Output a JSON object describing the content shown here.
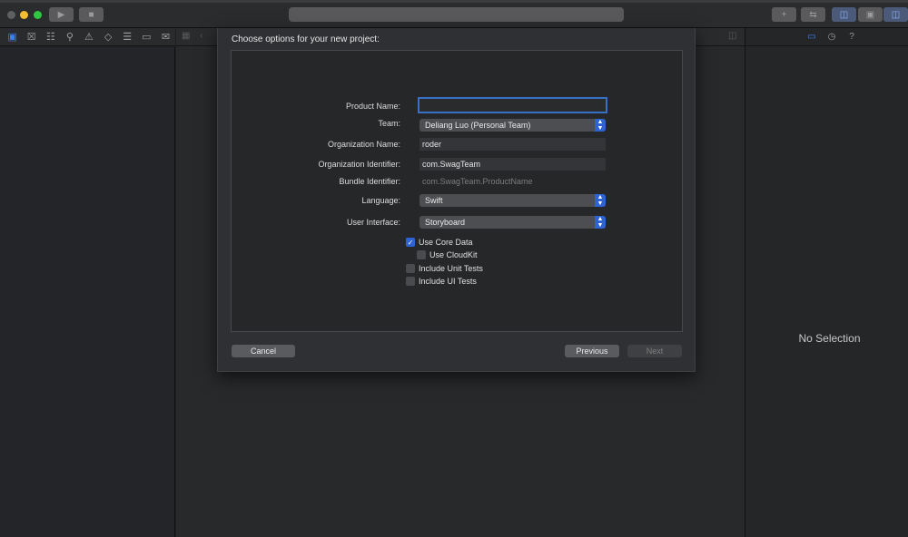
{
  "sheet": {
    "title": "Choose options for your new project:",
    "fields": {
      "product_name": {
        "label": "Product Name:",
        "value": ""
      },
      "team": {
        "label": "Team:",
        "value": "Deliang Luo (Personal Team)"
      },
      "organization_name": {
        "label": "Organization Name:",
        "value": "roder"
      },
      "organization_identifier": {
        "label": "Organization Identifier:",
        "value": "com.SwagTeam"
      },
      "bundle_identifier": {
        "label": "Bundle Identifier:",
        "value": "com.SwagTeam.ProductName"
      },
      "language": {
        "label": "Language:",
        "value": "Swift"
      },
      "user_interface": {
        "label": "User Interface:",
        "value": "Storyboard"
      }
    },
    "checkboxes": {
      "core_data": {
        "label": "Use Core Data",
        "checked": true
      },
      "cloudkit": {
        "label": "Use CloudKit",
        "checked": false
      },
      "unit_tests": {
        "label": "Include Unit Tests",
        "checked": false
      },
      "ui_tests": {
        "label": "Include UI Tests",
        "checked": false
      }
    },
    "buttons": {
      "cancel": "Cancel",
      "previous": "Previous",
      "next": "Next"
    }
  },
  "inspector": {
    "empty_text": "No Selection"
  },
  "colors": {
    "accent": "#2e63d6",
    "focus_ring": "#3a70c7",
    "sheet_bg": "#2f3033",
    "window_bg": "#1f2022"
  }
}
